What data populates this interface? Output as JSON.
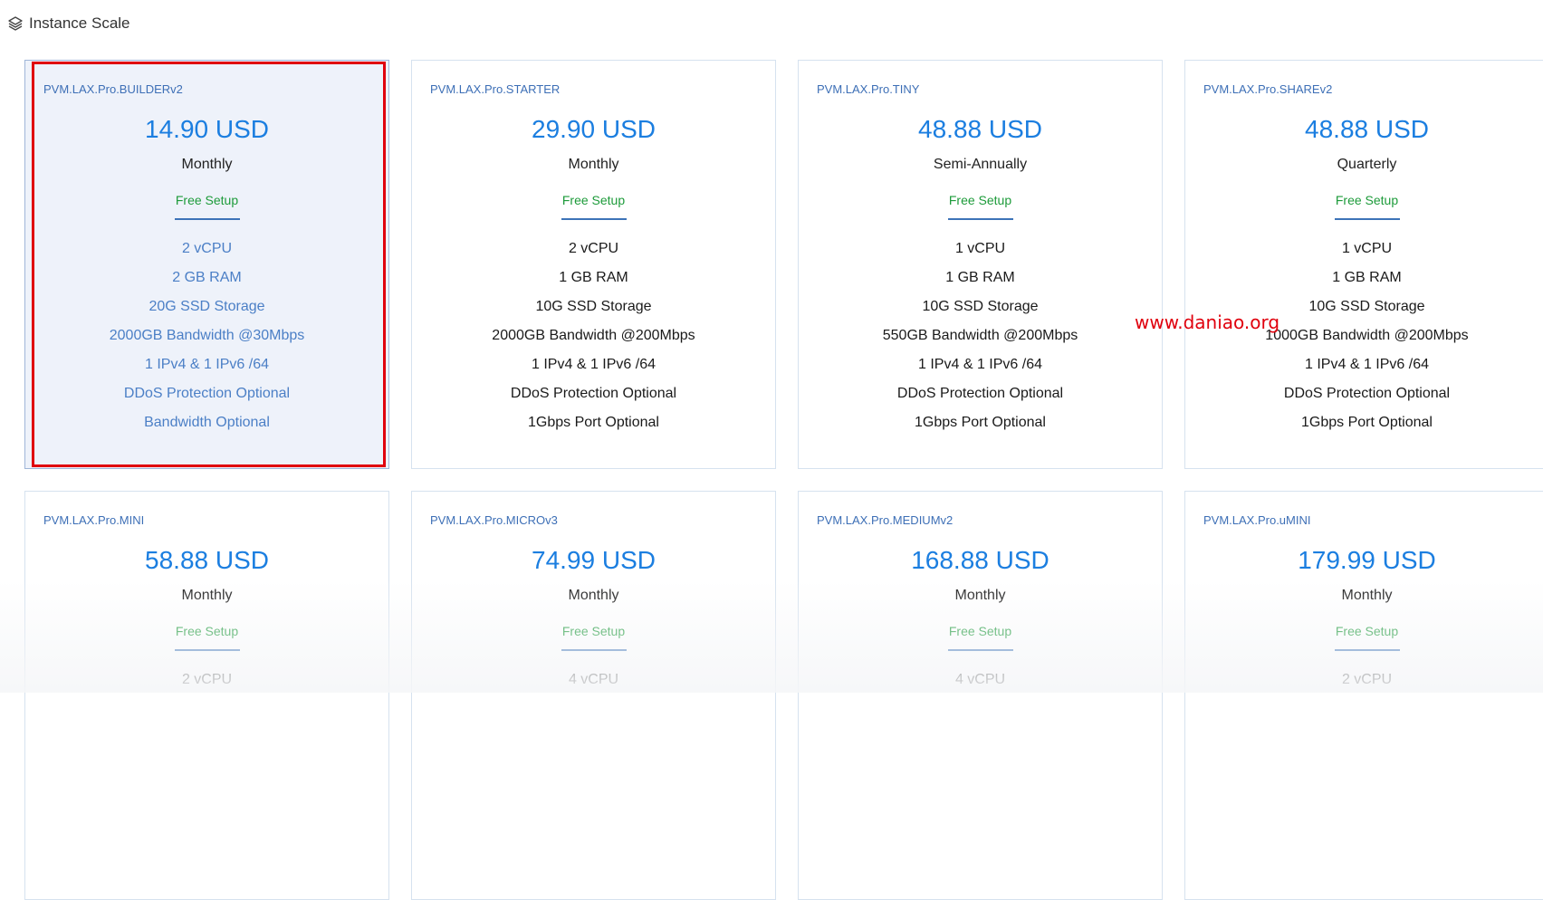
{
  "section": {
    "title": "Instance Scale",
    "icon": "layers-icon"
  },
  "watermark": "www.daniao.org",
  "colors": {
    "accent_blue": "#1b7ee0",
    "name_blue": "#3d6fb6",
    "free_setup_green": "#1d9b3a",
    "selection_red": "#e0000d"
  },
  "plans": [
    {
      "name": "PVM.LAX.Pro.BUILDERv2",
      "price": "14.90 USD",
      "cycle": "Monthly",
      "setup": "Free Setup",
      "selected": true,
      "features": [
        "2 vCPU",
        "2 GB RAM",
        "20G SSD Storage",
        "2000GB Bandwidth @30Mbps",
        "1 IPv4 & 1 IPv6 /64",
        "DDoS Protection Optional",
        "Bandwidth Optional"
      ]
    },
    {
      "name": "PVM.LAX.Pro.STARTER",
      "price": "29.90 USD",
      "cycle": "Monthly",
      "setup": "Free Setup",
      "features": [
        "2 vCPU",
        "1 GB RAM",
        "10G SSD Storage",
        "2000GB Bandwidth @200Mbps",
        "1 IPv4 & 1 IPv6 /64",
        "DDoS Protection Optional",
        "1Gbps Port Optional"
      ]
    },
    {
      "name": "PVM.LAX.Pro.TINY",
      "price": "48.88 USD",
      "cycle": "Semi-Annually",
      "setup": "Free Setup",
      "features": [
        "1 vCPU",
        "1 GB RAM",
        "10G SSD Storage",
        "550GB Bandwidth @200Mbps",
        "1 IPv4 & 1 IPv6 /64",
        "DDoS Protection Optional",
        "1Gbps Port Optional"
      ]
    },
    {
      "name": "PVM.LAX.Pro.SHAREv2",
      "price": "48.88 USD",
      "cycle": "Quarterly",
      "setup": "Free Setup",
      "features": [
        "1 vCPU",
        "1 GB RAM",
        "10G SSD Storage",
        "1000GB Bandwidth @200Mbps",
        "1 IPv4 & 1 IPv6 /64",
        "DDoS Protection Optional",
        "1Gbps Port Optional"
      ]
    },
    {
      "name": "PVM.LAX.Pro.MINI",
      "price": "58.88 USD",
      "cycle": "Monthly",
      "setup": "Free Setup",
      "features": [
        "2 vCPU"
      ]
    },
    {
      "name": "PVM.LAX.Pro.MICROv3",
      "price": "74.99 USD",
      "cycle": "Monthly",
      "setup": "Free Setup",
      "features": [
        "4 vCPU"
      ]
    },
    {
      "name": "PVM.LAX.Pro.MEDIUMv2",
      "price": "168.88 USD",
      "cycle": "Monthly",
      "setup": "Free Setup",
      "features": [
        "4 vCPU"
      ]
    },
    {
      "name": "PVM.LAX.Pro.uMINI",
      "price": "179.99 USD",
      "cycle": "Monthly",
      "setup": "Free Setup",
      "features": [
        "2 vCPU"
      ]
    }
  ]
}
